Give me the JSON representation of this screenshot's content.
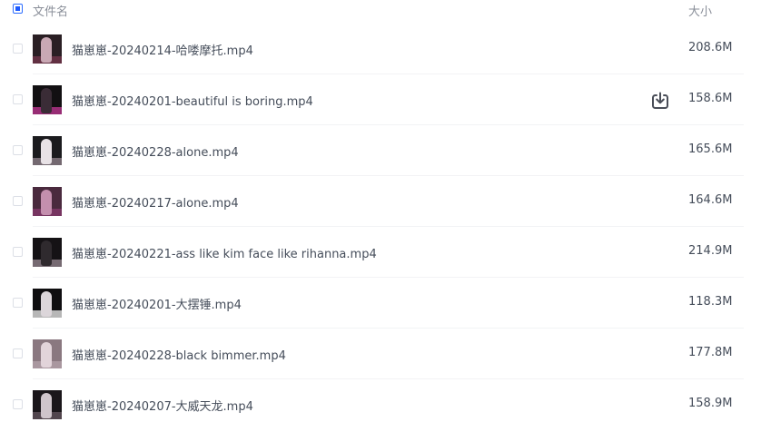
{
  "header": {
    "name_label": "文件名",
    "size_label": "大小"
  },
  "files": [
    {
      "name": "猫崽崽-20240214-哈喽摩托.mp4",
      "size": "208.6M",
      "thumb": {
        "bg": "#2a1f24",
        "fig": "#c9a8b4",
        "glow": "#7a3850"
      }
    },
    {
      "name": "猫崽崽-20240201-beautiful is boring.mp4",
      "size": "158.6M",
      "thumb": {
        "bg": "#121012",
        "fig": "#3a2c36",
        "glow": "#d23aa0"
      }
    },
    {
      "name": "猫崽崽-20240228-alone.mp4",
      "size": "165.6M",
      "thumb": {
        "bg": "#1b1b1e",
        "fig": "#e8e2e6",
        "glow": "#9a8a94"
      }
    },
    {
      "name": "猫崽崽-20240217-alone.mp4",
      "size": "164.6M",
      "thumb": {
        "bg": "#4a2a3e",
        "fig": "#c48fae",
        "glow": "#8a3a70"
      }
    },
    {
      "name": "猫崽崽-20240221-ass like kim face like rihanna.mp4",
      "size": "214.9M",
      "thumb": {
        "bg": "#151215",
        "fig": "#2f2a2e",
        "glow": "#a0909a"
      }
    },
    {
      "name": "猫崽崽-20240201-大摆锤.mp4",
      "size": "118.3M",
      "thumb": {
        "bg": "#0f0e10",
        "fig": "#dcd6da",
        "glow": "#ffffff"
      }
    },
    {
      "name": "猫崽崽-20240228-black bimmer.mp4",
      "size": "177.8M",
      "thumb": {
        "bg": "#8a7880",
        "fig": "#e2d4da",
        "glow": "#b6a4ac"
      }
    },
    {
      "name": "猫崽崽-20240207-大威天龙.mp4",
      "size": "158.9M",
      "thumb": {
        "bg": "#1a161a",
        "fig": "#cfc5cb",
        "glow": "#6a5a64"
      }
    }
  ],
  "hovered_row": 1,
  "download_icon": "download-icon",
  "colors": {
    "accent": "#1e5bff",
    "text": "#454d5a",
    "muted": "#8a8f99",
    "icon": "#4a4e58"
  }
}
